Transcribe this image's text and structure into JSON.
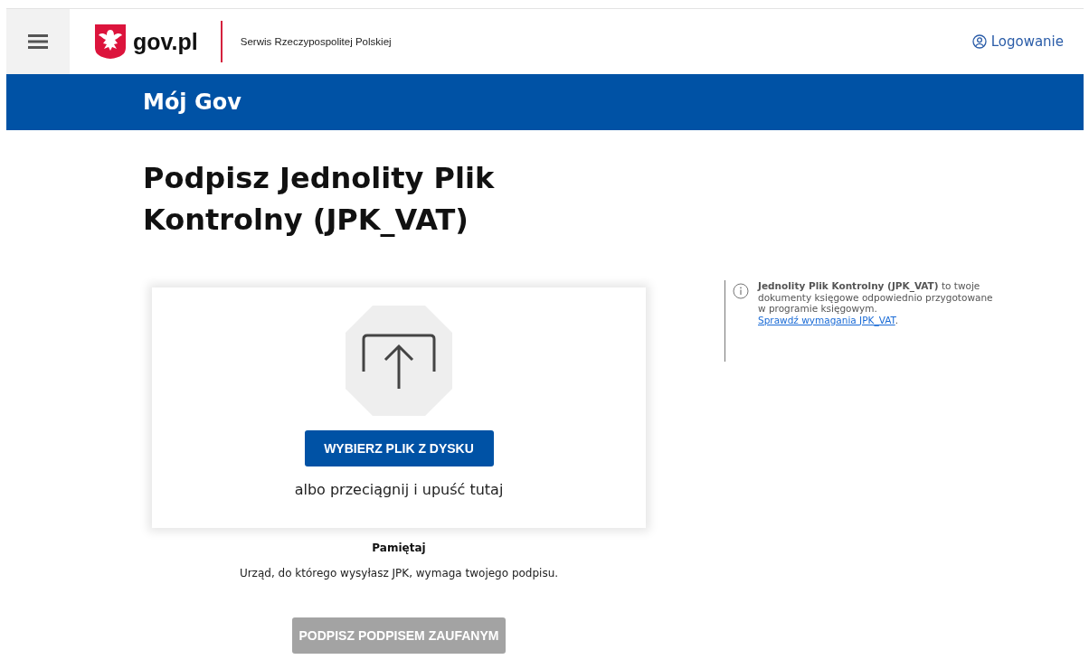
{
  "header": {
    "logo_text": "gov.pl",
    "tagline": "Serwis Rzeczypospolitej Polskiej",
    "login": "Logowanie"
  },
  "band": {
    "title": "Mój Gov"
  },
  "page": {
    "title": "Podpisz Jednolity Plik Kontrolny (JPK_VAT)"
  },
  "upload": {
    "button": "WYBIERZ PLIK Z DYSKU",
    "hint": "albo przeciągnij i upuść tutaj"
  },
  "remember": {
    "title": "Pamiętaj",
    "text": "Urząd, do którego wysyłasz JPK, wymaga twojego podpisu."
  },
  "sign_button": {
    "label": "PODPISZ PODPISEM ZAUFANYM",
    "disabled": true
  },
  "info": {
    "text": "**Jednolity Plik Kontrolny (JPK_VAT)** to twoje dokumenty księgowe odpowiednio przygotowane w programie księgowym.",
    "link": "Sprawdź wymagania JPK_VAT",
    "after": "."
  }
}
